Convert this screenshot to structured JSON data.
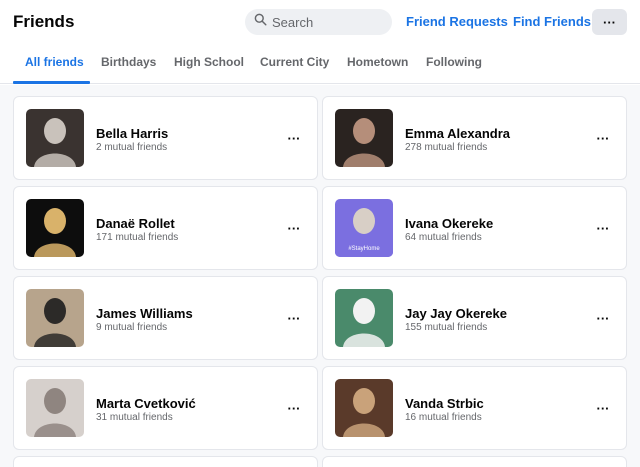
{
  "header": {
    "title": "Friends",
    "search_placeholder": "Search",
    "friend_requests": "Friend Requests",
    "find_friends": "Find Friends",
    "more_label": "···"
  },
  "tabs": [
    {
      "label": "All friends",
      "active": true
    },
    {
      "label": "Birthdays",
      "active": false
    },
    {
      "label": "High School",
      "active": false
    },
    {
      "label": "Current City",
      "active": false
    },
    {
      "label": "Hometown",
      "active": false
    },
    {
      "label": "Following",
      "active": false
    }
  ],
  "friends": [
    {
      "name": "Bella Harris",
      "mutual": "2 mutual friends",
      "avatar_colors": [
        "#3a3330",
        "#c9c2bb"
      ]
    },
    {
      "name": "Emma Alexandra",
      "mutual": "278 mutual friends",
      "avatar_colors": [
        "#2a2320",
        "#b58e7a"
      ]
    },
    {
      "name": "Danaë Rollet",
      "mutual": "171 mutual friends",
      "avatar_colors": [
        "#0d0d0d",
        "#d9b26a"
      ]
    },
    {
      "name": "Ivana Okereke",
      "mutual": "64 mutual friends",
      "avatar_colors": [
        "#7b6fe0",
        "#d8cfc6"
      ],
      "avatar_banner": "#StayHome"
    },
    {
      "name": "James Williams",
      "mutual": "9 mutual friends",
      "avatar_colors": [
        "#b7a48c",
        "#2c2a28"
      ]
    },
    {
      "name": "Jay Jay Okereke",
      "mutual": "155 mutual friends",
      "avatar_colors": [
        "#4a8a6b",
        "#f2f2f2"
      ]
    },
    {
      "name": "Marta Cvetković",
      "mutual": "31 mutual friends",
      "avatar_colors": [
        "#d6d0cc",
        "#8f8580"
      ]
    },
    {
      "name": "Vanda Strbic",
      "mutual": "16 mutual friends",
      "avatar_colors": [
        "#5a3a2a",
        "#c9a27a"
      ]
    }
  ],
  "card_more_label": "···",
  "colors": {
    "accent": "#1b74e4",
    "text_secondary": "#65676b",
    "background": "#ffffff"
  },
  "icons": {
    "search": "search-icon",
    "more": "more-dots-icon"
  }
}
